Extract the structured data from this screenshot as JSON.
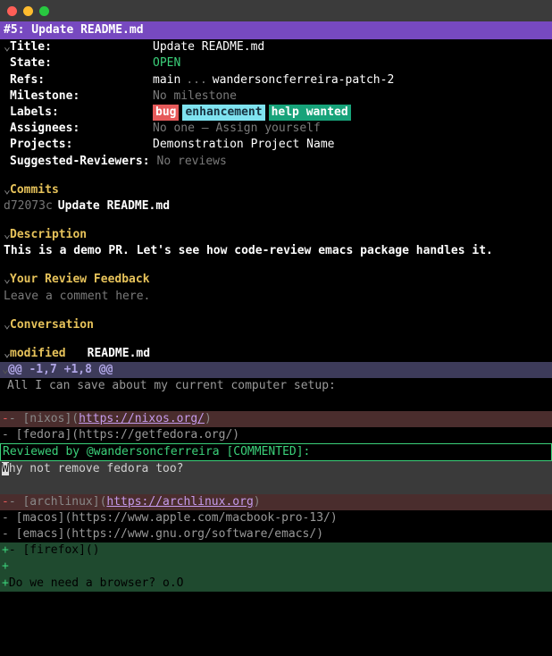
{
  "window": {
    "title": "#5: Update README.md"
  },
  "meta": {
    "title_label": "Title:",
    "title_value": "Update README.md",
    "state_label": "State:",
    "state_value": "OPEN",
    "refs_label": "Refs:",
    "refs_base": "main",
    "refs_sep": "...",
    "refs_head": "wandersoncferreira-patch-2",
    "milestone_label": "Milestone:",
    "milestone_value": "No milestone",
    "labels_label": "Labels:",
    "label_bug": "bug",
    "label_enh": "enhancement",
    "label_help": "help wanted",
    "assignees_label": "Assignees:",
    "assignees_value": "No one – Assign yourself",
    "projects_label": "Projects:",
    "projects_value": "Demonstration Project Name",
    "reviewers_label": "Suggested-Reviewers:",
    "reviewers_value": "No reviews"
  },
  "sections": {
    "commits": "Commits",
    "commit_hash": "d72073c",
    "commit_msg": "Update README.md",
    "description": "Description",
    "description_body": "This is a demo PR. Let's see how code-review emacs package handles it.",
    "feedback": "Your Review Feedback",
    "feedback_placeholder": "Leave a comment here.",
    "conversation": "Conversation",
    "modified_label": "modified",
    "modified_file": "README.md"
  },
  "diff": {
    "hunk": "@@ -1,7 +1,8 @@",
    "ctx1": "All I can save about my current computer setup:",
    "del_nixos_pre": "- [nixos](",
    "del_nixos_url": "https://nixos.org/",
    "del_nixos_post": ")",
    "keep_fedora": " - [fedora](https://getfedora.org/)",
    "review_line": "Reviewed by @wandersoncferreira [COMMENTED]:",
    "comment_pre": "W",
    "comment_rest": "hy not remove fedora too?",
    "del_arch_pre": "- [archlinux](",
    "del_arch_url": "https://archlinux.org",
    "del_arch_post": ")",
    "keep_macos": " - [macos](https://www.apple.com/macbook-pro-13/)",
    "keep_emacs": " - [emacs](https://www.gnu.org/software/emacs/)",
    "add_firefox": "- [firefox]()",
    "add_blank": "",
    "add_browser": "Do we need a browser? o.O"
  },
  "glyph": {
    "caret": "⌄",
    "minus": "-",
    "plus": "+"
  }
}
